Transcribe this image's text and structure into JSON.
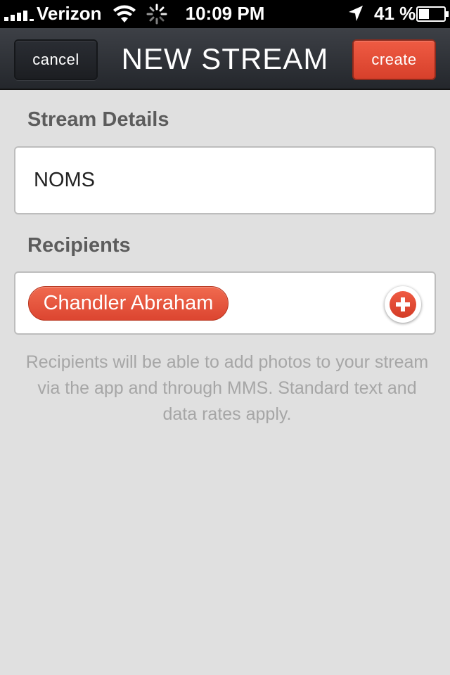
{
  "status_bar": {
    "carrier": "Verizon",
    "time": "10:09 PM",
    "battery_percent": "41 %",
    "battery_level": 0.41,
    "icons": [
      "signal-icon",
      "wifi-icon",
      "activity-spinner-icon",
      "location-arrow-icon",
      "battery-icon"
    ]
  },
  "nav": {
    "title": "NEW STREAM",
    "cancel_label": "cancel",
    "create_label": "create"
  },
  "stream_details": {
    "heading": "Stream Details",
    "name_value": "NOMS"
  },
  "recipients": {
    "heading": "Recipients",
    "items": [
      {
        "name": "Chandler Abraham"
      }
    ],
    "add_icon": "plus-icon"
  },
  "help_text": "Recipients will be able to add photos to your stream via the app and through MMS. Standard text and data rates apply.",
  "colors": {
    "accent": "#e24b34",
    "nav_bg": "#2f3238",
    "page_bg": "#e0e0e0",
    "heading": "#5c5c5c",
    "help_text": "#a6a6a6"
  }
}
